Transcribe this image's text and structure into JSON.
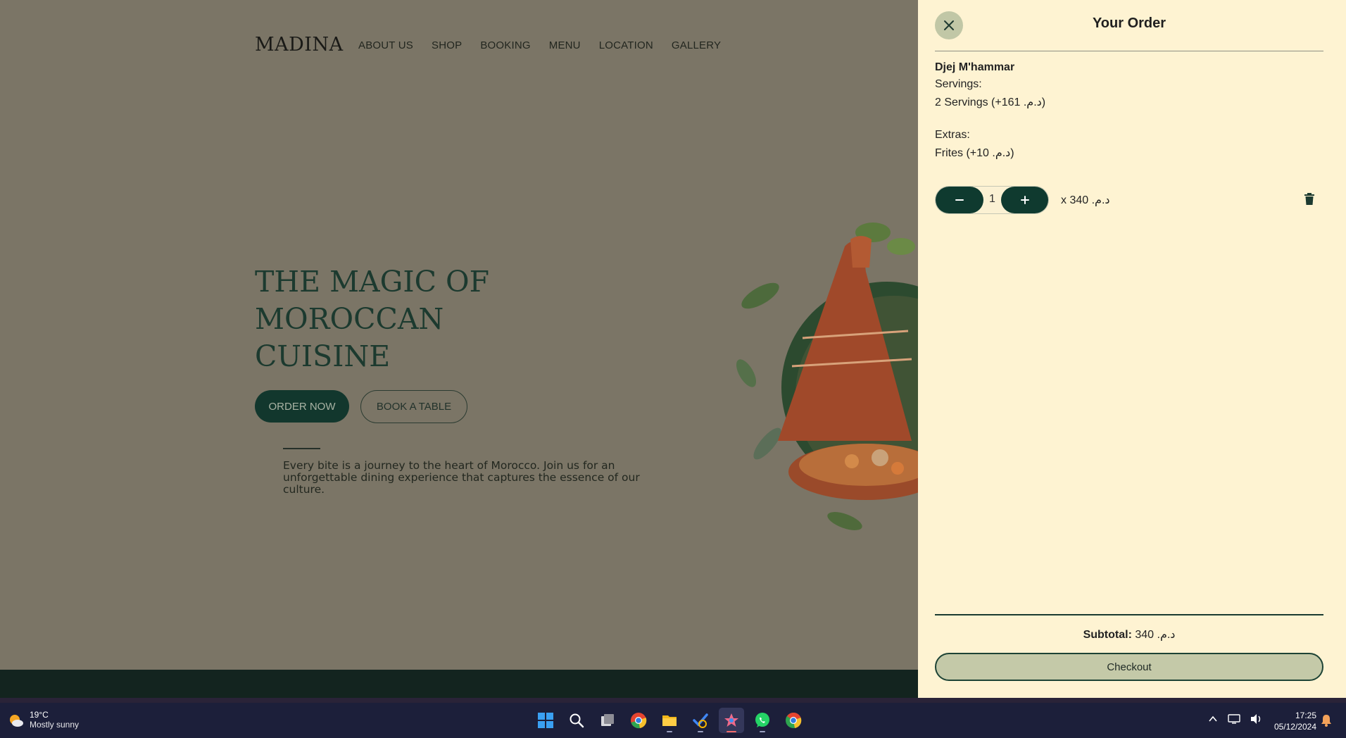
{
  "site": {
    "brand": "MADINA",
    "nav": [
      "ABOUT US",
      "SHOP",
      "BOOKING",
      "MENU",
      "LOCATION",
      "GALLERY"
    ],
    "hero_title_lines": [
      "THE MAGIC OF",
      "MOROCCAN",
      "CUISINE"
    ],
    "order_now": "ORDER NOW",
    "book_table": "BOOK A TABLE",
    "hero_text": "Every bite is a journey to the heart of Morocco. Join us for an unforgettable dining experience that captures the essence of our culture."
  },
  "order": {
    "title": "Your Order",
    "item": {
      "name": "Djej M'hammar",
      "servings_label": "Servings:",
      "servings_value": "2 Servings (+161 .د.م)",
      "extras_label": "Extras:",
      "extras_value": "Frites (+10 .د.م)",
      "quantity": "1",
      "price": "x  340 .د.م"
    },
    "subtotal_label": "Subtotal:",
    "subtotal_value": " 340 .د.م",
    "checkout": "Checkout"
  },
  "taskbar": {
    "temperature": "19°C",
    "weather": "Mostly sunny",
    "time": "17:25",
    "date": "05/12/2024",
    "apps": [
      "start-icon",
      "search-icon",
      "task-view-icon",
      "chrome-icon",
      "file-explorer-icon",
      "todo-icon",
      "paint-icon",
      "whatsapp-icon",
      "chrome-alt-icon"
    ]
  },
  "colors": {
    "drawer_bg": "#fef3d2",
    "brand_green": "#0f3a2f",
    "checkout_bg": "#c4c9a8",
    "backdrop": "#7b7566"
  }
}
